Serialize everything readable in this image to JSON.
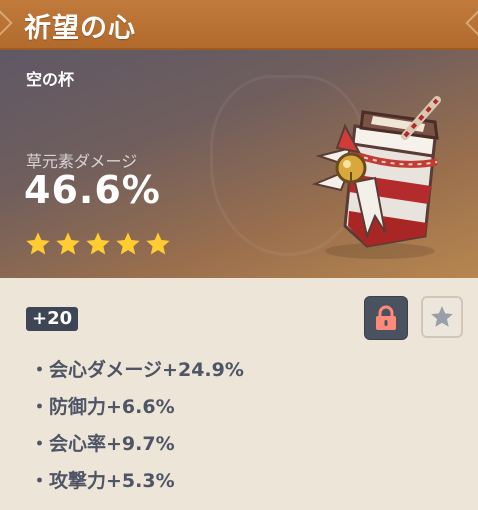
{
  "header": {
    "title": "祈望の心"
  },
  "artifact": {
    "slot": "空の杯",
    "main_stat_name": "草元素ダメージ",
    "main_stat_value": "46.6%",
    "rarity": 5,
    "level": "+20"
  },
  "substats": [
    "・会心ダメージ+24.9%",
    "・防御力+6.6%",
    "・会心率+9.7%",
    "・攻撃力+5.3%"
  ],
  "colors": {
    "title_bar": "#b8702f",
    "star": "#ffcc32",
    "lock": "#ff8a7a",
    "badge": "#3e4555",
    "substat_text": "#4f5566"
  },
  "icons": {
    "lock": "lock-icon",
    "favorite": "star-icon",
    "rarity": "star-icon"
  }
}
